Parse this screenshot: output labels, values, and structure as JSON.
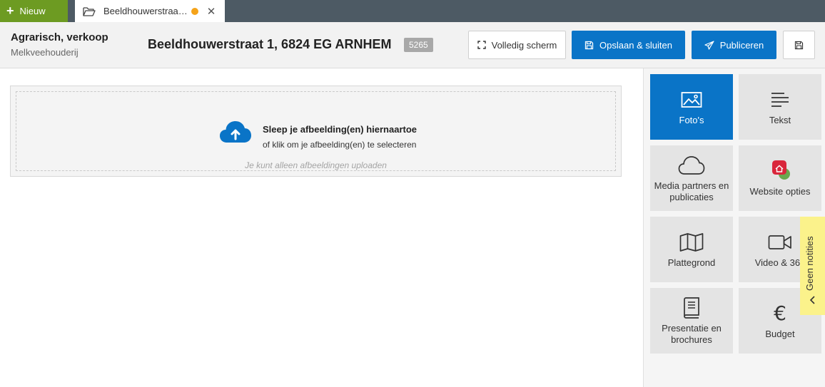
{
  "tabs": {
    "new_label": "Nieuw",
    "document_label": "Beeldhouwerstraa…",
    "unsaved_dot_color": "#f5a31a"
  },
  "header": {
    "category": "Agrarisch, verkoop",
    "subcategory": "Melkveehouderij",
    "address": "Beeldhouwerstraat 1, 6824 EG ARNHEM",
    "id_badge": "5265",
    "fullscreen_label": "Volledig scherm",
    "save_close_label": "Opslaan & sluiten",
    "publish_label": "Publiceren"
  },
  "dropzone": {
    "title": "Sleep je afbeelding(en) hiernaartoe",
    "subtitle": "of klik om je afbeelding(en) te selecteren",
    "note": "Je kunt alleen afbeeldingen uploaden"
  },
  "side_menu": {
    "items": [
      {
        "label": "Foto's",
        "icon": "image-icon",
        "active": true
      },
      {
        "label": "Tekst",
        "icon": "text-lines-icon"
      },
      {
        "label": "Media partners en publicaties",
        "icon": "cloud-icon"
      },
      {
        "label": "Website opties",
        "icon": "website-badge-icon"
      },
      {
        "label": "Plattegrond",
        "icon": "map-icon"
      },
      {
        "label": "Video & 360",
        "icon": "video-camera-icon"
      },
      {
        "label": "Presentatie en brochures",
        "icon": "book-icon"
      },
      {
        "label": "Budget",
        "icon": "euro-icon"
      }
    ]
  },
  "notes": {
    "label": "Geen notities"
  },
  "colors": {
    "accent_blue": "#0a74c7",
    "new_green": "#6d9b22",
    "topbar": "#4d5a64",
    "notes_yellow": "#fbf28b"
  }
}
